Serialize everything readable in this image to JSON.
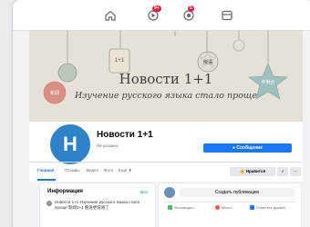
{
  "topbar": {
    "icons": [
      "home-icon",
      "video-icon",
      "marketplace-icon",
      "groups-icon"
    ],
    "video_badge": "9+",
    "marketplace_badge": "5"
  },
  "cover": {
    "title": "Новости 1+1",
    "subtitle": "Изучение русского языка стало проще",
    "ornaments": [
      "1+1",
      "俄语",
      "新闻",
      "中俄合"
    ]
  },
  "profile": {
    "avatar_letter": "H",
    "name": "Новости 1+1",
    "category": "Не указано",
    "message_button": "Сообщение"
  },
  "tabs": [
    "Главная",
    "Отзывы",
    "Видео",
    "Фото",
    "Ещё ▼"
  ],
  "actions": {
    "like_button": "Нравится",
    "search_symbol": "⌕",
    "more_symbol": "···"
  },
  "info": {
    "title": "Информация",
    "see_all": "Все",
    "text": "Новости 1+1 Изучение русского языка стало проще 新闻1+1 俄语更容易了"
  },
  "post": {
    "create_label": "Создать публикацию",
    "actions": [
      {
        "label": "Фото/видео",
        "color": "#45bd62"
      },
      {
        "label": "Место",
        "color": "#f5533d"
      },
      {
        "label": "Отметить друзей",
        "color": "#1877f2"
      }
    ]
  },
  "colors": {
    "brand": "#1877f2",
    "avatar": "#2e83c8",
    "badge": "#e41e3f"
  }
}
